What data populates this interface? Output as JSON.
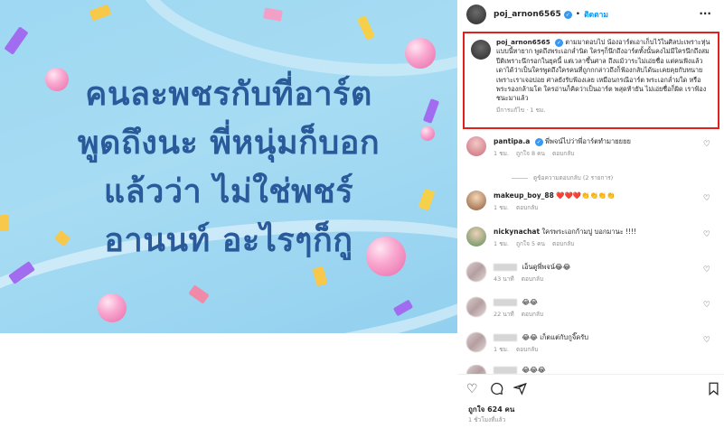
{
  "image": {
    "lines": [
      "คนละพชรกับที่อาร์ต",
      "พูดถึงนะ พี่หนุ่มก็บอก",
      "แล้วว่า ไม่ใช่พชร์",
      "อานนท์ อะไรๆก็กู"
    ],
    "text_color": "#2b5a9a",
    "background_color": "#a7dcf3"
  },
  "header": {
    "username": "poj_arnon6565",
    "separator": "•",
    "follow_label": "ติดตาม",
    "more_icon": "more-horizontal-icon"
  },
  "caption": {
    "username": "poj_arnon6565",
    "text": "ตามมาตอบไป น้องอาร์ตเอาเก็บไว้ในศิลปะเพราะหุ่นแบบนี้หายาก พูดถึงพระเอกล่ำนิด ใครๆก็นึกถึงอาร์ตทั้งนั้นคงไม่มีใครนึกถึงสมปีติเพราะนึกรอกในยุคนี้ แต่เวลาขึ้นศาล ถึงแม้วาระไม่เอ่ยชื่อ แต่คนฟังแล้วเดาได้ว่าเป็นใครพูดถึงใครคนที่ถูกกกล่าวถึงก็ฟ้องกลับได้นะเคยคุยกับทนาย เพราะเราเจอบ่อย ศาลยังรับฟ้องเลย เหมือนกรณีอาร์ต พระเอกล่ำมใด หรือพระรองกล้ามโต ใครอ่านก็คิดว่าเป็นอาร์ต พสุดท้ายัน ไม่เอ่ยชื่อก็ผิด เราฟ้องชนะมาแล้ว",
    "meta": "มีการแก้ไข · 1 ชม.",
    "border_color": "#e0201b"
  },
  "comments": [
    {
      "username": "pantipa.a",
      "text": "พี่พจน์ไปว่าพี่อาร์ตทำมายยยย",
      "time": "1 ชม.",
      "likes": "ถูกใจ 8 คน",
      "reply": "ตอบกลับ",
      "view_replies": "ดูข้อความตอบกลับ (2 รายการ)",
      "avatar_icon": "user-avatar-icon"
    },
    {
      "username": "makeup_boy_88",
      "text": "❤️❤️❤️👏👏👏👏",
      "time": "1 ชม.",
      "reply": "ตอบกลับ"
    },
    {
      "username": "nickynachat",
      "text": "ใครพระเอกก้ามปู บอกมานะ !!!!",
      "time": "1 ชม.",
      "likes": "ถูกใจ 5 คน",
      "reply": "ตอบกลับ"
    },
    {
      "text": "เอ็นดูพี่พจน์😂😂",
      "time": "43 นาที",
      "reply": "ตอบกลับ"
    },
    {
      "text": "😂😂",
      "time": "22 นาที",
      "reply": "ตอบกลับ"
    },
    {
      "text": "😂😂 เก็ตแต่กับกูจิ๊ครับ",
      "time": "1 ชม.",
      "reply": "ตอบกลับ"
    },
    {
      "text": "😂😂😂"
    }
  ],
  "footer": {
    "likes": "ถูกใจ 624 คน",
    "time": "1 ชั่วโมงที่แล้ว",
    "icons": [
      "heart-icon",
      "comment-icon",
      "share-icon",
      "bookmark-icon"
    ]
  }
}
